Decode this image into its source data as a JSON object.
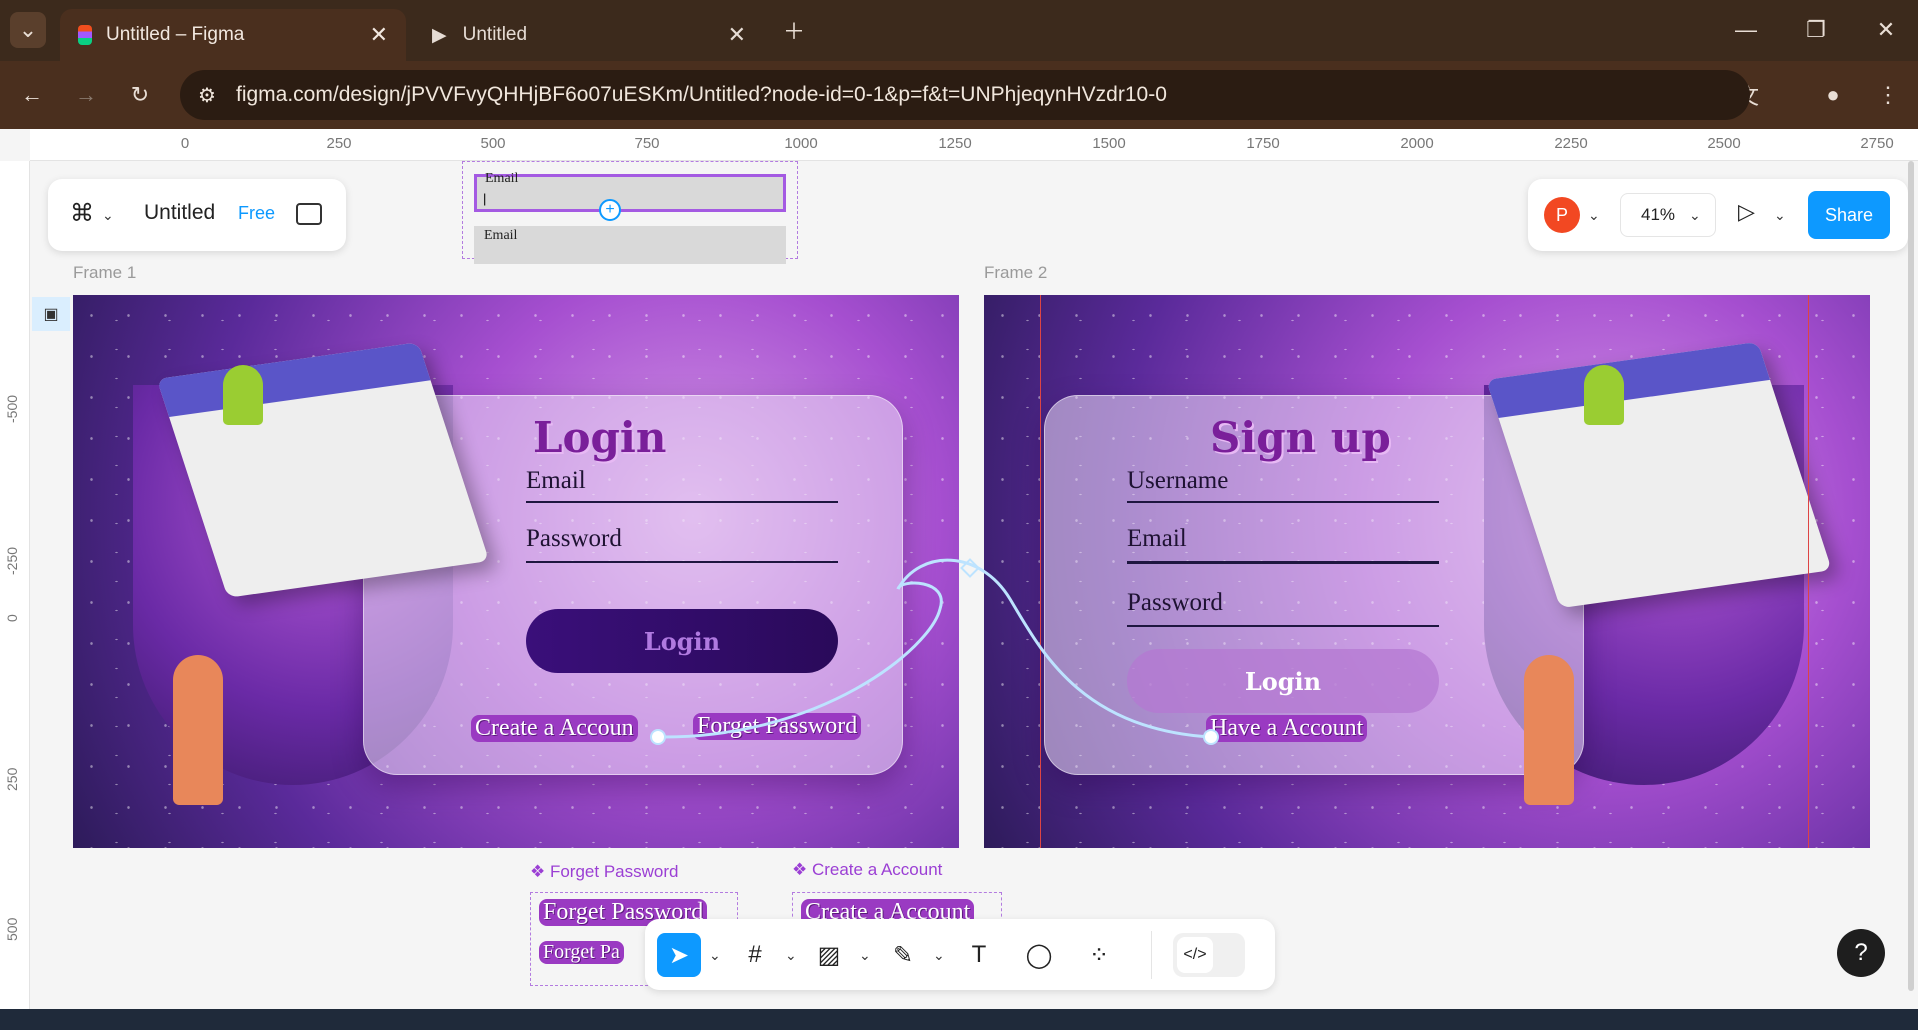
{
  "browser": {
    "tabs": [
      {
        "label": "Untitled – Figma",
        "active": true
      },
      {
        "label": "Untitled",
        "active": false
      }
    ],
    "url": "figma.com/design/jPVVFvyQHHjBF6o07uESKm/Untitled?node-id=0-1&p=f&t=UNPhjeqynHVzdr10-0"
  },
  "file": {
    "name": "Untitled",
    "plan": "Free"
  },
  "topright": {
    "avatar": "P",
    "zoom": "41%",
    "share_label": "Share"
  },
  "rulers": {
    "top": [
      "0",
      "250",
      "500",
      "750",
      "1000",
      "1250",
      "1500",
      "1750",
      "2000",
      "2250",
      "2500",
      "2750"
    ],
    "left": [
      "-500",
      "-250",
      "0",
      "250",
      "500"
    ]
  },
  "mini_component": {
    "label1": "Email",
    "label2": "Email"
  },
  "frame1": {
    "name": "Frame 1",
    "title": "Login",
    "fields": [
      "Email",
      "Password"
    ],
    "button": "Login",
    "link_create": "Create a Accoun",
    "link_forget": "Forget Password"
  },
  "frame2": {
    "name": "Frame 2",
    "title": "Sign up",
    "fields": [
      "Username",
      "Email",
      "Password"
    ],
    "button": "Login",
    "link_have": "Have a Account"
  },
  "components": {
    "forget": {
      "label": "❖ Forget Password",
      "text1": "Forget Password",
      "text2": "Forget Pa"
    },
    "create": {
      "label": "❖ Create a Account",
      "text1": "Create a Account"
    }
  },
  "help_label": "?",
  "colors": {
    "accent": "#0d99ff",
    "component": "#9b3fd4",
    "chrome": "#4a2f1e"
  }
}
